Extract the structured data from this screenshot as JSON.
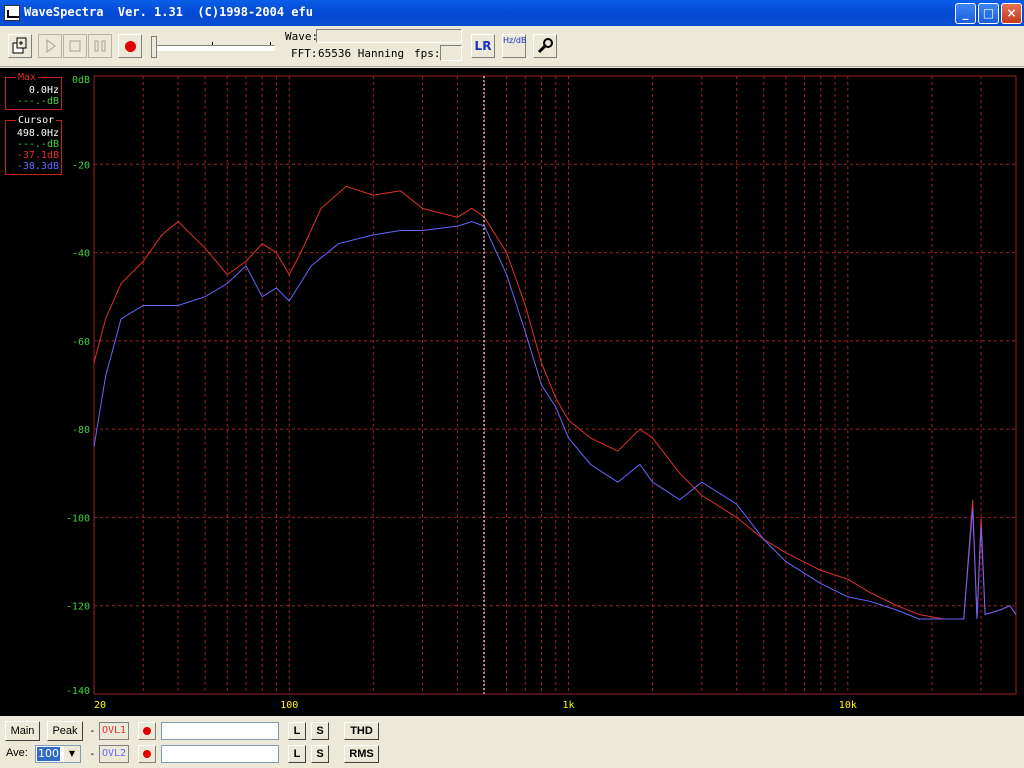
{
  "window": {
    "title": "WaveSpectra  Ver. 1.31  (C)1998-2004 efu",
    "minimize": "_",
    "maximize": "□",
    "close": "×"
  },
  "toolbar": {
    "wave_label": "Wave:",
    "fft_label": "FFT:",
    "fft_value": "65536 Hanning",
    "fps_label": "fps:",
    "lr_label": "LR",
    "hzdb_label": "Hz/dB",
    "volume_level": 0.0
  },
  "readouts": {
    "max": {
      "title": "Max",
      "freq": "0.0Hz",
      "level": "---.-dB"
    },
    "cursor": {
      "title": "Cursor",
      "freq": "498.0Hz",
      "l1": "---.-dB",
      "l2": "-37.1dB",
      "l3": "-38.3dB"
    }
  },
  "colors": {
    "red_trace": "#e03030",
    "blue_trace": "#6666ff",
    "grid": "#a02020",
    "axis_text": "#ffff00",
    "green_text": "#40d040"
  },
  "chart_data": {
    "type": "line",
    "xscale": "log",
    "xlim": [
      20,
      24000
    ],
    "ylim": [
      -140,
      0
    ],
    "x_ticks": [
      "20",
      "100",
      "1k",
      "10k"
    ],
    "y_ticks": [
      "0dB",
      "-20",
      "-40",
      "-60",
      "-80",
      "-100",
      "-120",
      "-140"
    ],
    "cursor_x": 498,
    "series": [
      {
        "color": "#e03030",
        "points": [
          [
            20,
            -65
          ],
          [
            22,
            -55
          ],
          [
            25,
            -47
          ],
          [
            30,
            -42
          ],
          [
            35,
            -36
          ],
          [
            40,
            -33
          ],
          [
            50,
            -39
          ],
          [
            60,
            -45
          ],
          [
            70,
            -42
          ],
          [
            80,
            -38
          ],
          [
            90,
            -40
          ],
          [
            100,
            -45
          ],
          [
            110,
            -40
          ],
          [
            130,
            -30
          ],
          [
            160,
            -25
          ],
          [
            200,
            -27
          ],
          [
            250,
            -26
          ],
          [
            300,
            -30
          ],
          [
            400,
            -32
          ],
          [
            450,
            -30
          ],
          [
            500,
            -32
          ],
          [
            600,
            -40
          ],
          [
            700,
            -52
          ],
          [
            800,
            -65
          ],
          [
            900,
            -73
          ],
          [
            1000,
            -78
          ],
          [
            1200,
            -82
          ],
          [
            1500,
            -85
          ],
          [
            1800,
            -80
          ],
          [
            2000,
            -82
          ],
          [
            2500,
            -90
          ],
          [
            3000,
            -95
          ],
          [
            4000,
            -100
          ],
          [
            5000,
            -105
          ],
          [
            6000,
            -108
          ],
          [
            8000,
            -112
          ],
          [
            10000,
            -114
          ],
          [
            12000,
            -117
          ],
          [
            15000,
            -120
          ],
          [
            18000,
            -122
          ],
          [
            22000,
            -123
          ],
          [
            26000,
            -123
          ],
          [
            28000,
            -96
          ],
          [
            29000,
            -123
          ],
          [
            30000,
            -100
          ],
          [
            31000,
            -122
          ],
          [
            35000,
            -121
          ],
          [
            38000,
            -120
          ],
          [
            40000,
            -122
          ]
        ]
      },
      {
        "color": "#6666ff",
        "points": [
          [
            20,
            -84
          ],
          [
            22,
            -68
          ],
          [
            25,
            -55
          ],
          [
            30,
            -52
          ],
          [
            40,
            -52
          ],
          [
            50,
            -50
          ],
          [
            60,
            -47
          ],
          [
            70,
            -43
          ],
          [
            80,
            -50
          ],
          [
            90,
            -48
          ],
          [
            100,
            -51
          ],
          [
            120,
            -43
          ],
          [
            150,
            -38
          ],
          [
            200,
            -36
          ],
          [
            250,
            -35
          ],
          [
            300,
            -35
          ],
          [
            400,
            -34
          ],
          [
            450,
            -33
          ],
          [
            500,
            -34
          ],
          [
            600,
            -45
          ],
          [
            700,
            -58
          ],
          [
            800,
            -70
          ],
          [
            900,
            -75
          ],
          [
            1000,
            -82
          ],
          [
            1200,
            -88
          ],
          [
            1500,
            -92
          ],
          [
            1800,
            -88
          ],
          [
            2000,
            -92
          ],
          [
            2500,
            -96
          ],
          [
            3000,
            -92
          ],
          [
            4000,
            -97
          ],
          [
            5000,
            -105
          ],
          [
            6000,
            -110
          ],
          [
            8000,
            -115
          ],
          [
            10000,
            -118
          ],
          [
            12000,
            -119
          ],
          [
            15000,
            -121
          ],
          [
            18000,
            -123
          ],
          [
            22000,
            -123
          ],
          [
            26000,
            -123
          ],
          [
            28000,
            -98
          ],
          [
            29000,
            -123
          ],
          [
            30000,
            -102
          ],
          [
            31000,
            -122
          ],
          [
            35000,
            -121
          ],
          [
            38000,
            -120
          ],
          [
            40000,
            -122
          ]
        ]
      }
    ]
  },
  "bottom": {
    "main_label": "Main",
    "peak_label": "Peak",
    "dash1": "-",
    "dash2": "-",
    "ovl1_label": "OVL1",
    "ovl2_label": "OVL2",
    "l_label": "L",
    "s_label": "S",
    "thd_label": "THD",
    "rms_label": "RMS",
    "ave_label": "Ave:",
    "ave_value": "100"
  }
}
